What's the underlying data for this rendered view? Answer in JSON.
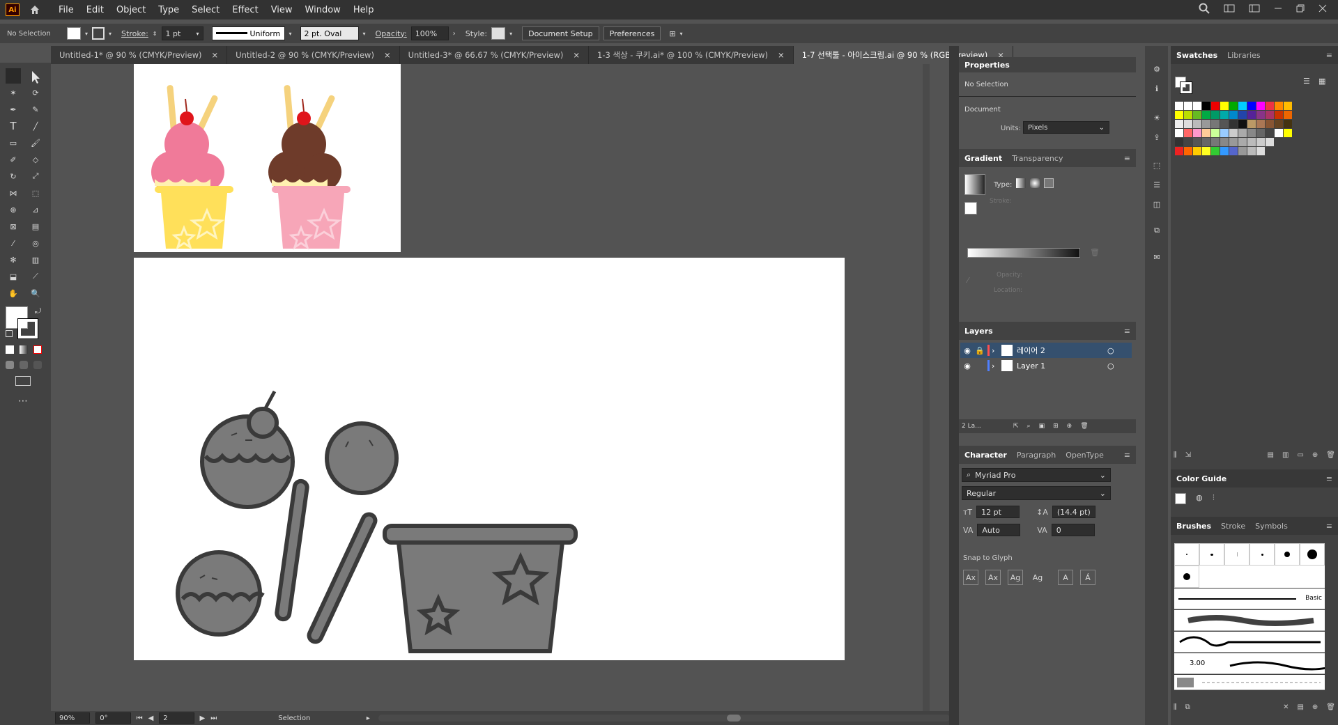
{
  "app": {
    "logo": "Ai"
  },
  "menu": [
    "File",
    "Edit",
    "Object",
    "Type",
    "Select",
    "Effect",
    "View",
    "Window",
    "Help"
  ],
  "control": {
    "selection": "No Selection",
    "stroke_label": "Stroke:",
    "stroke_weight": "1 pt",
    "profile": "Uniform",
    "brush": "2 pt. Oval",
    "opacity_label": "Opacity:",
    "opacity": "100%",
    "style_label": "Style:",
    "doc_setup": "Document Setup",
    "preferences": "Preferences"
  },
  "tabs": [
    {
      "label": "Untitled-1* @ 90 % (CMYK/Preview)",
      "active": false
    },
    {
      "label": "Untitled-2 @ 90 % (CMYK/Preview)",
      "active": false
    },
    {
      "label": "Untitled-3* @ 66.67 % (CMYK/Preview)",
      "active": false
    },
    {
      "label": "1-3 색상 - 쿠키.ai* @ 100 % (CMYK/Preview)",
      "active": false
    },
    {
      "label": "1-7 선택툴 - 아이스크림.ai @ 90 % (RGB/Preview)",
      "active": true
    }
  ],
  "tab_close": "×",
  "status": {
    "zoom": "90%",
    "rotate": "0°",
    "artboard": "2",
    "tool": "Selection"
  },
  "properties": {
    "title": "Properties",
    "selection": "No Selection",
    "document": "Document",
    "units_label": "Units:",
    "units": "Pixels"
  },
  "gradient": {
    "tab1": "Gradient",
    "tab2": "Transparency",
    "type_label": "Type:",
    "stroke_label": "Stroke:",
    "opacity_label": "Opacity:",
    "location_label": "Location:"
  },
  "layers": {
    "title": "Layers",
    "items": [
      {
        "name": "레이어 2",
        "color": "#ff4f4f",
        "selected": true
      },
      {
        "name": "Layer 1",
        "color": "#4f7fff",
        "selected": false
      }
    ],
    "count": "2 La..."
  },
  "character": {
    "tab1": "Character",
    "tab2": "Paragraph",
    "tab3": "OpenType",
    "font": "Myriad Pro",
    "style": "Regular",
    "size": "12 pt",
    "leading": "(14.4 pt)",
    "kerning": "Auto",
    "tracking": "0",
    "snap": "Snap to Glyph"
  },
  "swatches": {
    "tab1": "Swatches",
    "tab2": "Libraries"
  },
  "color_guide": {
    "title": "Color Guide"
  },
  "brushes": {
    "tab1": "Brushes",
    "tab2": "Stroke",
    "tab3": "Symbols",
    "basic": "Basic",
    "size": "3.00"
  },
  "colors": {
    "accent": "#ff9a00",
    "panel": "#424242",
    "canvas": "#535353"
  }
}
